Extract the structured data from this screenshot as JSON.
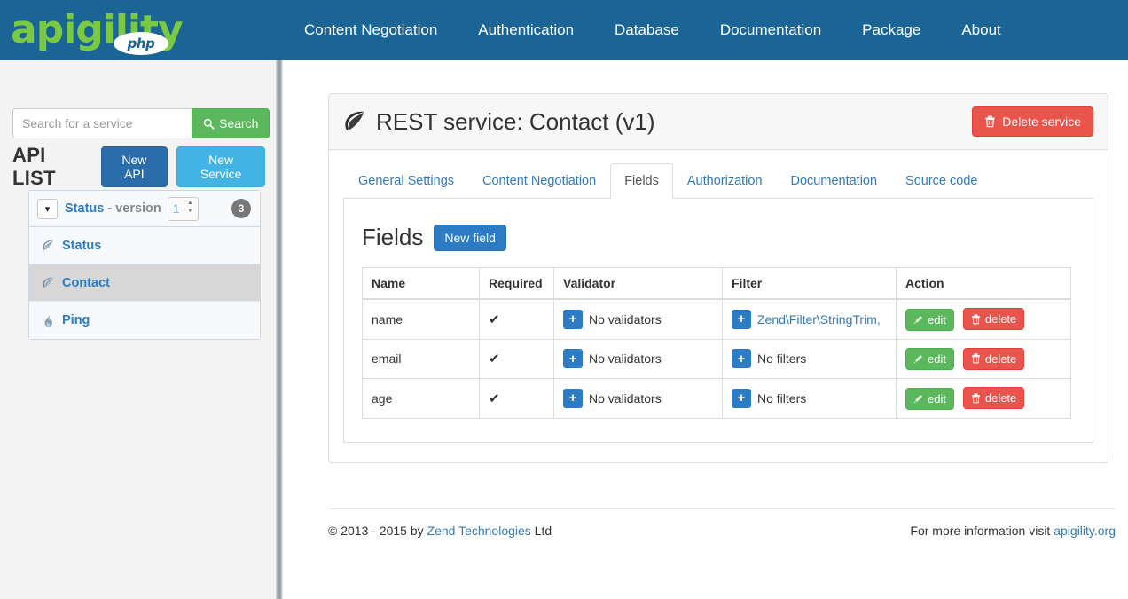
{
  "navbar": {
    "brand_text": "apigility",
    "brand_badge": "php",
    "links": [
      {
        "label": "Content Negotiation"
      },
      {
        "label": "Authentication"
      },
      {
        "label": "Database"
      },
      {
        "label": "Documentation"
      },
      {
        "label": "Package"
      },
      {
        "label": "About"
      }
    ],
    "bg_color": "#1a6496",
    "brand_color": "#7ac943"
  },
  "sidebar": {
    "search": {
      "placeholder": "Search for a service",
      "value": "",
      "button_label": "Search",
      "button_icon": "search-icon"
    },
    "api_list_title": "API LIST",
    "new_api_label": "New API",
    "new_service_label": "New Service",
    "api": {
      "caret_icon": "chevron-down-icon",
      "name": "Status",
      "version_label": "- version",
      "version_value": "1",
      "count_badge": "3",
      "services": [
        {
          "label": "Status",
          "icon": "leaf-icon",
          "active": false
        },
        {
          "label": "Contact",
          "icon": "leaf-icon",
          "active": true
        },
        {
          "label": "Ping",
          "icon": "flame-icon",
          "active": false
        }
      ]
    }
  },
  "main": {
    "panel_title": "REST service: Contact (v1)",
    "panel_title_icon": "leaf-icon",
    "delete_service_label": "Delete service",
    "delete_service_icon": "trash-icon",
    "tabs": [
      {
        "label": "General Settings",
        "active": false
      },
      {
        "label": "Content Negotiation",
        "active": false
      },
      {
        "label": "Fields",
        "active": true
      },
      {
        "label": "Authorization",
        "active": false
      },
      {
        "label": "Documentation",
        "active": false
      },
      {
        "label": "Source code",
        "active": false
      }
    ],
    "fields_title": "Fields",
    "new_field_label": "New field",
    "table": {
      "headers": [
        "Name",
        "Required",
        "Validator",
        "Filter",
        "Action"
      ],
      "rows": [
        {
          "name": "name",
          "required": "✔",
          "validator": "No validators",
          "filter": "Zend\\Filter\\StringTrim,",
          "filter_is_link": true,
          "edit_label": "edit",
          "delete_label": "delete"
        },
        {
          "name": "email",
          "required": "✔",
          "validator": "No validators",
          "filter": "No filters",
          "filter_is_link": false,
          "edit_label": "edit",
          "delete_label": "delete"
        },
        {
          "name": "age",
          "required": "✔",
          "validator": "No validators",
          "filter": "No filters",
          "filter_is_link": false,
          "edit_label": "edit",
          "delete_label": "delete"
        }
      ]
    }
  },
  "footer": {
    "copyright_prefix": "© 2013 - 2015 by ",
    "copyright_link": "Zend Technologies",
    "copyright_suffix": " Ltd",
    "info_prefix": "For more information visit ",
    "info_link": "apigility.org"
  },
  "colors": {
    "primary": "#2b7cc4",
    "success": "#5cb85c",
    "danger": "#e9554c",
    "info": "#42b3e5",
    "link": "#337ab7"
  }
}
